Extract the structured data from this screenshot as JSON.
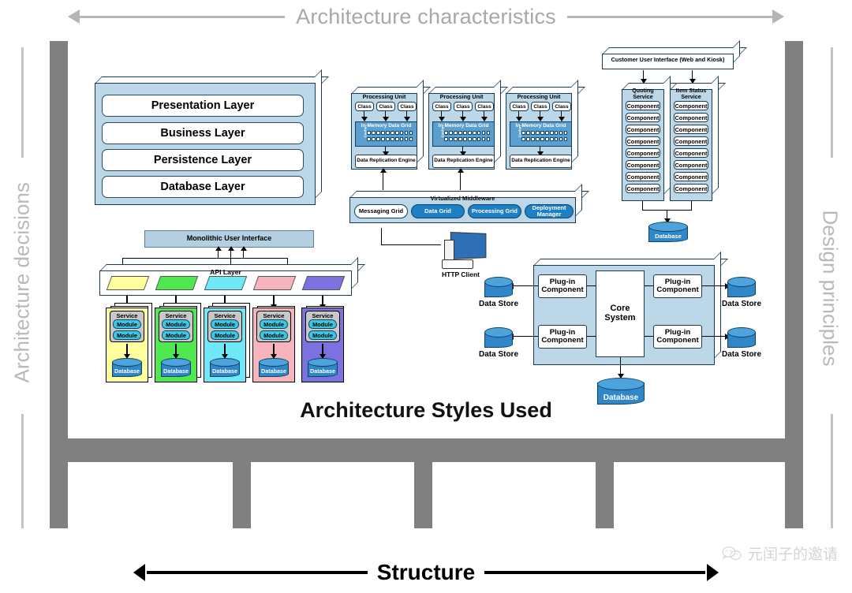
{
  "frame": {
    "top_label": "Architecture characteristics",
    "bottom_label": "Structure",
    "left_label": "Architecture decisions",
    "right_label": "Design principles",
    "gray": "#808080"
  },
  "center_title": "Architecture Styles Used",
  "watermark": "元闰子的邀请",
  "layered": {
    "layers": [
      {
        "label": "Presentation Layer"
      },
      {
        "label": "Business Layer"
      },
      {
        "label": "Persistence Layer"
      },
      {
        "label": "Database Layer"
      }
    ]
  },
  "space_based": {
    "processing_units": [
      {
        "title": "Processing Unit",
        "classes": [
          "Class",
          "Class",
          "Class"
        ],
        "grid": "In-Memory Data Grid",
        "cache": "Cache",
        "engine": "Data Replication Engine"
      },
      {
        "title": "Processing Unit",
        "classes": [
          "Class",
          "Class",
          "Class"
        ],
        "grid": "In-Memory Data Grid",
        "cache": "Cache",
        "engine": "Data Replication Engine"
      },
      {
        "title": "Processing Unit",
        "classes": [
          "Class",
          "Class",
          "Class"
        ],
        "grid": "In-Memory Data Grid",
        "cache": "Cache",
        "engine": "Data Replication Engine"
      }
    ],
    "middleware_title": "Virtualized Middleware",
    "middleware_items": [
      {
        "label": "Messaging Grid",
        "style": "white"
      },
      {
        "label": "Data Grid",
        "style": "blue"
      },
      {
        "label": "Processing Grid",
        "style": "blue"
      },
      {
        "label": "Deployment Manager",
        "style": "blue"
      }
    ],
    "client_label": "HTTP Client"
  },
  "service_based": {
    "ui_label": "Customer User Interface (Web and Kiosk)",
    "services": [
      {
        "name": "Quoting Service",
        "components": [
          "Component",
          "Component",
          "Component",
          "Component",
          "Component",
          "Component",
          "Component",
          "Component"
        ]
      },
      {
        "name": "Item Status Service",
        "components": [
          "Component",
          "Component",
          "Component",
          "Component",
          "Component",
          "Component",
          "Component",
          "Component"
        ]
      }
    ],
    "database_label": "Database"
  },
  "microkernel": {
    "core_label": "Core System",
    "plugins": [
      {
        "label": "Plug-in Component"
      },
      {
        "label": "Plug-in Component"
      },
      {
        "label": "Plug-in Component"
      },
      {
        "label": "Plug-in Component"
      }
    ],
    "data_stores": [
      {
        "label": "Data Store"
      },
      {
        "label": "Data Store"
      },
      {
        "label": "Data Store"
      },
      {
        "label": "Data Store"
      }
    ],
    "database_label": "Database"
  },
  "microservices": {
    "ui_label": "Monolithic User Interface",
    "api_label": "API Layer",
    "services": [
      {
        "service_label": "Service",
        "modules": [
          "Module",
          "Module"
        ],
        "database_label": "Database",
        "color": "#ffff9e",
        "api_color": "#ffff9e"
      },
      {
        "service_label": "Service",
        "modules": [
          "Module",
          "Module"
        ],
        "database_label": "Database",
        "color": "#4fe84f",
        "api_color": "#4fe84f"
      },
      {
        "service_label": "Service",
        "modules": [
          "Module",
          "Module"
        ],
        "database_label": "Database",
        "color": "#6fe9f7",
        "api_color": "#6fe9f7"
      },
      {
        "service_label": "Service",
        "modules": [
          "Module",
          "Module"
        ],
        "database_label": "Database",
        "color": "#f6b4bc",
        "api_color": "#f6b4bc"
      },
      {
        "service_label": "Service",
        "modules": [
          "Module",
          "Module"
        ],
        "database_label": "Database",
        "color": "#7b72e0",
        "api_color": "#7b72e0"
      }
    ]
  }
}
